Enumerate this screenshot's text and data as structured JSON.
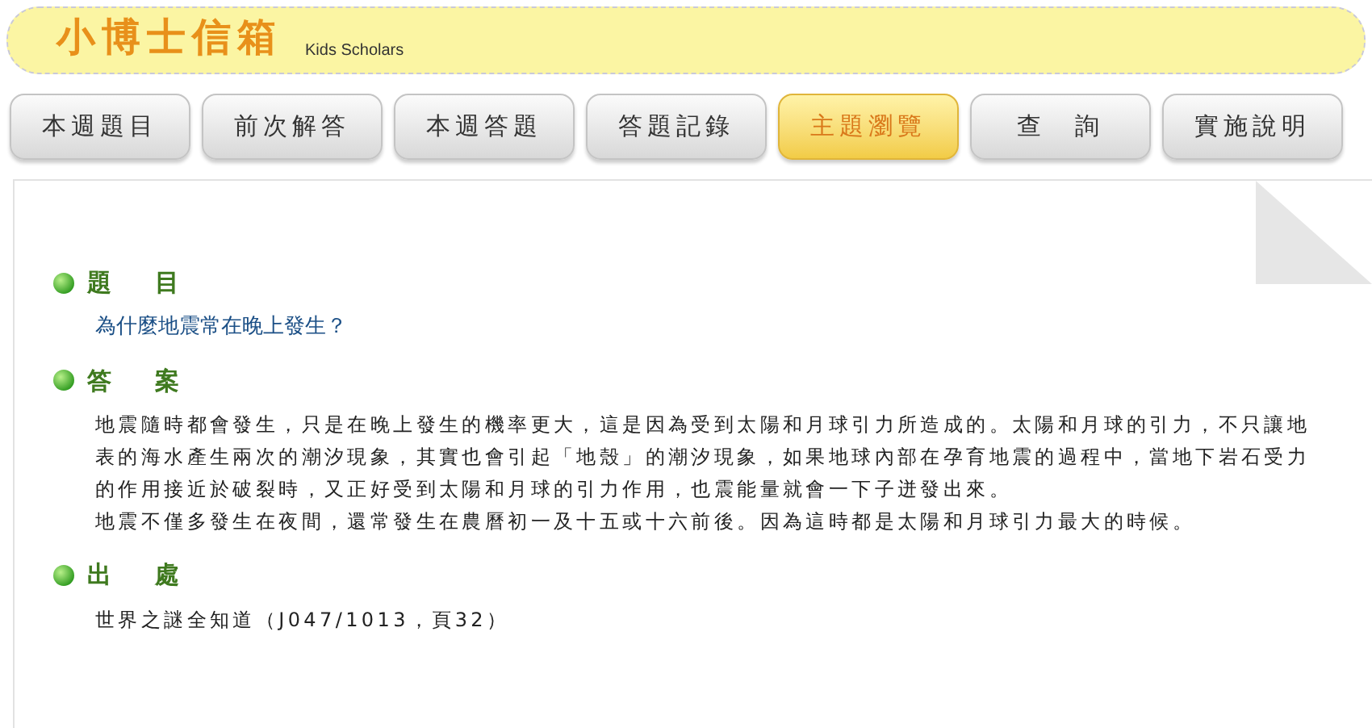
{
  "header": {
    "logo": "小博士信箱",
    "subtitle": "Kids Scholars"
  },
  "tabs": [
    {
      "label": "本週題目",
      "selected": false
    },
    {
      "label": "前次解答",
      "selected": false
    },
    {
      "label": "本週答題",
      "selected": false
    },
    {
      "label": "答題記錄",
      "selected": false
    },
    {
      "label": "主題瀏覽",
      "selected": true
    },
    {
      "label": "查　詢",
      "selected": false
    },
    {
      "label": "實施說明",
      "selected": false
    }
  ],
  "sections": [
    {
      "heading": "題　目",
      "kind": "question",
      "paragraphs": [
        "為什麼地震常在晚上發生？"
      ]
    },
    {
      "heading": "答　案",
      "kind": "text",
      "paragraphs": [
        "地震隨時都會發生，只是在晚上發生的機率更大，這是因為受到太陽和月球引力所造成的。太陽和月球的引力，不只讓地表的海水產生兩次的潮汐現象，其實也會引起「地殼」的潮汐現象，如果地球內部在孕育地震的過程中，當地下岩石受力的作用接近於破裂時，又正好受到太陽和月球的引力作用，也震能量就會一下子迸發出來。",
        "地震不僅多發生在夜間，還常發生在農曆初一及十五或十六前後。因為這時都是太陽和月球引力最大的時候。"
      ]
    },
    {
      "heading": "出　處",
      "kind": "text",
      "paragraphs": [
        "世界之謎全知道（J047/1013，頁32）"
      ]
    }
  ]
}
